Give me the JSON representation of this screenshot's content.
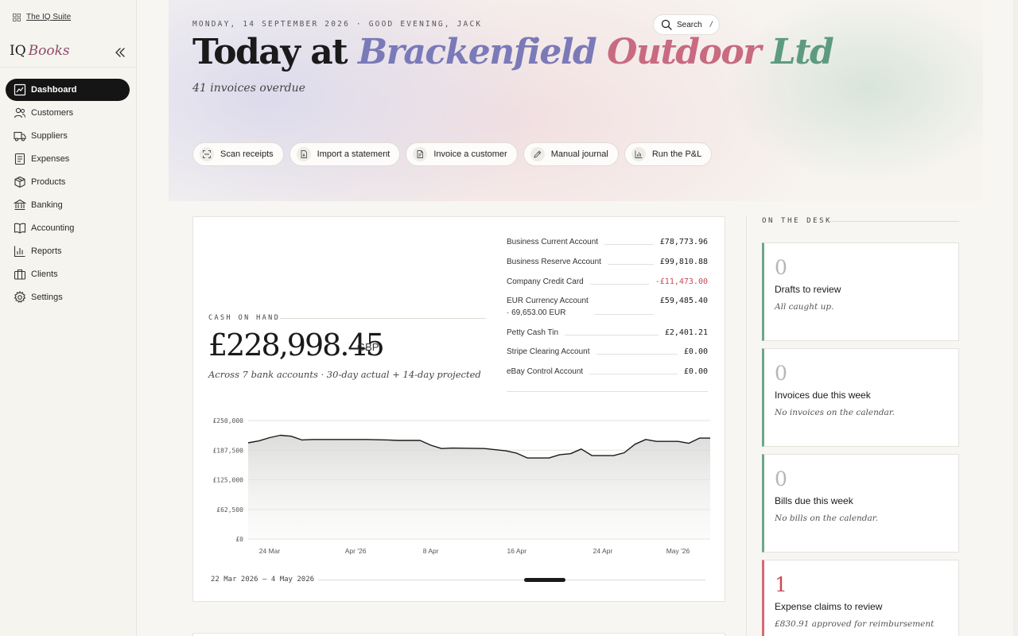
{
  "sidebar": {
    "suite_link": "The IQ Suite",
    "brand_iq": "IQ",
    "brand_books": "Books",
    "items": [
      {
        "label": "Dashboard",
        "icon": "dashboard-icon",
        "active": true
      },
      {
        "label": "Customers",
        "icon": "customers-icon"
      },
      {
        "label": "Suppliers",
        "icon": "truck-icon"
      },
      {
        "label": "Expenses",
        "icon": "receipt-icon"
      },
      {
        "label": "Products",
        "icon": "box-icon"
      },
      {
        "label": "Banking",
        "icon": "bank-icon"
      },
      {
        "label": "Accounting",
        "icon": "book-icon"
      },
      {
        "label": "Reports",
        "icon": "bar-chart-icon"
      },
      {
        "label": "Clients",
        "icon": "briefcase-icon"
      },
      {
        "label": "Settings",
        "icon": "gear-icon"
      }
    ]
  },
  "header": {
    "dateline": "MONDAY, 14 SEPTEMBER 2026 · GOOD EVENING, JACK",
    "title_prefix": "Today at",
    "company_word1": "Brackenfield",
    "company_word2": "Outdoor",
    "company_word3": "Ltd",
    "overdue": "41 invoices overdue",
    "search_label": "Search",
    "search_shortcut": "/"
  },
  "actions": [
    {
      "label": "Scan receipts",
      "icon": "scan-icon"
    },
    {
      "label": "Import a statement",
      "icon": "file-import-icon"
    },
    {
      "label": "Invoice a customer",
      "icon": "invoice-icon"
    },
    {
      "label": "Manual journal",
      "icon": "pencil-icon"
    },
    {
      "label": "Run the P&L",
      "icon": "bar-chart-icon"
    }
  ],
  "cash": {
    "label": "CASH ON HAND",
    "amount": "£228,998.45",
    "currency": "GBP",
    "subtitle": "Across 7 bank accounts · 30-day actual + 14-day projected",
    "range": "22 Mar 2026 – 4 May 2026"
  },
  "accounts": [
    {
      "name": "Business Current Account",
      "balance": "£78,773.96"
    },
    {
      "name": "Business Reserve Account",
      "balance": "£99,810.88"
    },
    {
      "name": "Company Credit Card",
      "balance": "-£11,473.00",
      "negative": true
    },
    {
      "name": "EUR Currency Account",
      "sub": "· 69,653.00 EUR",
      "balance": "£59,485.40"
    },
    {
      "name": "Petty Cash Tin",
      "balance": "£2,401.21"
    },
    {
      "name": "Stripe Clearing Account",
      "balance": "£0.00"
    },
    {
      "name": "eBay Control Account",
      "balance": "£0.00"
    }
  ],
  "desk": {
    "label": "ON THE DESK",
    "tiles": [
      {
        "count": "0",
        "title": "Drafts to review",
        "sub": "All caught up.",
        "status_color": "#6fa58c"
      },
      {
        "count": "0",
        "title": "Invoices due this week",
        "sub": "No invoices on the calendar.",
        "status_color": "#6fa58c"
      },
      {
        "count": "0",
        "title": "Bills due this week",
        "sub": "No bills on the calendar.",
        "status_color": "#6fa58c"
      },
      {
        "count": "1",
        "title": "Expense claims to review",
        "sub": "£830.91 approved for reimbursement",
        "status_color": "#d36a78"
      }
    ]
  },
  "chart_data": {
    "type": "area",
    "x_start": "2026-03-22",
    "x_end": "2026-05-04",
    "x_ticks": [
      "24 Mar",
      "Apr '26",
      "8 Apr",
      "16 Apr",
      "24 Apr",
      "May '26"
    ],
    "y_ticks": [
      "£0",
      "£62,500",
      "£125,000",
      "£187,500",
      "£250,000"
    ],
    "ylim": [
      0,
      250000
    ],
    "grid": true,
    "series": [
      {
        "values": [
          [
            "2026-03-22",
            203000
          ],
          [
            "2026-03-23",
            207000
          ],
          [
            "2026-03-24",
            214000
          ],
          [
            "2026-03-25",
            219000
          ],
          [
            "2026-03-26",
            217000
          ],
          [
            "2026-03-27",
            209000
          ],
          [
            "2026-03-28",
            210000
          ],
          [
            "2026-03-31",
            210000
          ],
          [
            "2026-04-02",
            210000
          ],
          [
            "2026-04-04",
            209000
          ],
          [
            "2026-04-05",
            208000
          ],
          [
            "2026-04-07",
            208000
          ],
          [
            "2026-04-08",
            198000
          ],
          [
            "2026-04-09",
            191000
          ],
          [
            "2026-04-10",
            192000
          ],
          [
            "2026-04-13",
            191000
          ],
          [
            "2026-04-15",
            186000
          ],
          [
            "2026-04-16",
            181000
          ],
          [
            "2026-04-17",
            171000
          ],
          [
            "2026-04-19",
            171000
          ],
          [
            "2026-04-20",
            178000
          ],
          [
            "2026-04-21",
            180000
          ],
          [
            "2026-04-22",
            190000
          ],
          [
            "2026-04-23",
            176000
          ],
          [
            "2026-04-25",
            176000
          ],
          [
            "2026-04-26",
            182000
          ],
          [
            "2026-04-27",
            200000
          ],
          [
            "2026-04-28",
            210000
          ],
          [
            "2026-04-29",
            206000
          ],
          [
            "2026-04-30",
            206000
          ],
          [
            "2026-05-01",
            206000
          ],
          [
            "2026-05-02",
            202000
          ],
          [
            "2026-05-03",
            213000
          ],
          [
            "2026-05-04",
            213000
          ]
        ]
      }
    ]
  }
}
